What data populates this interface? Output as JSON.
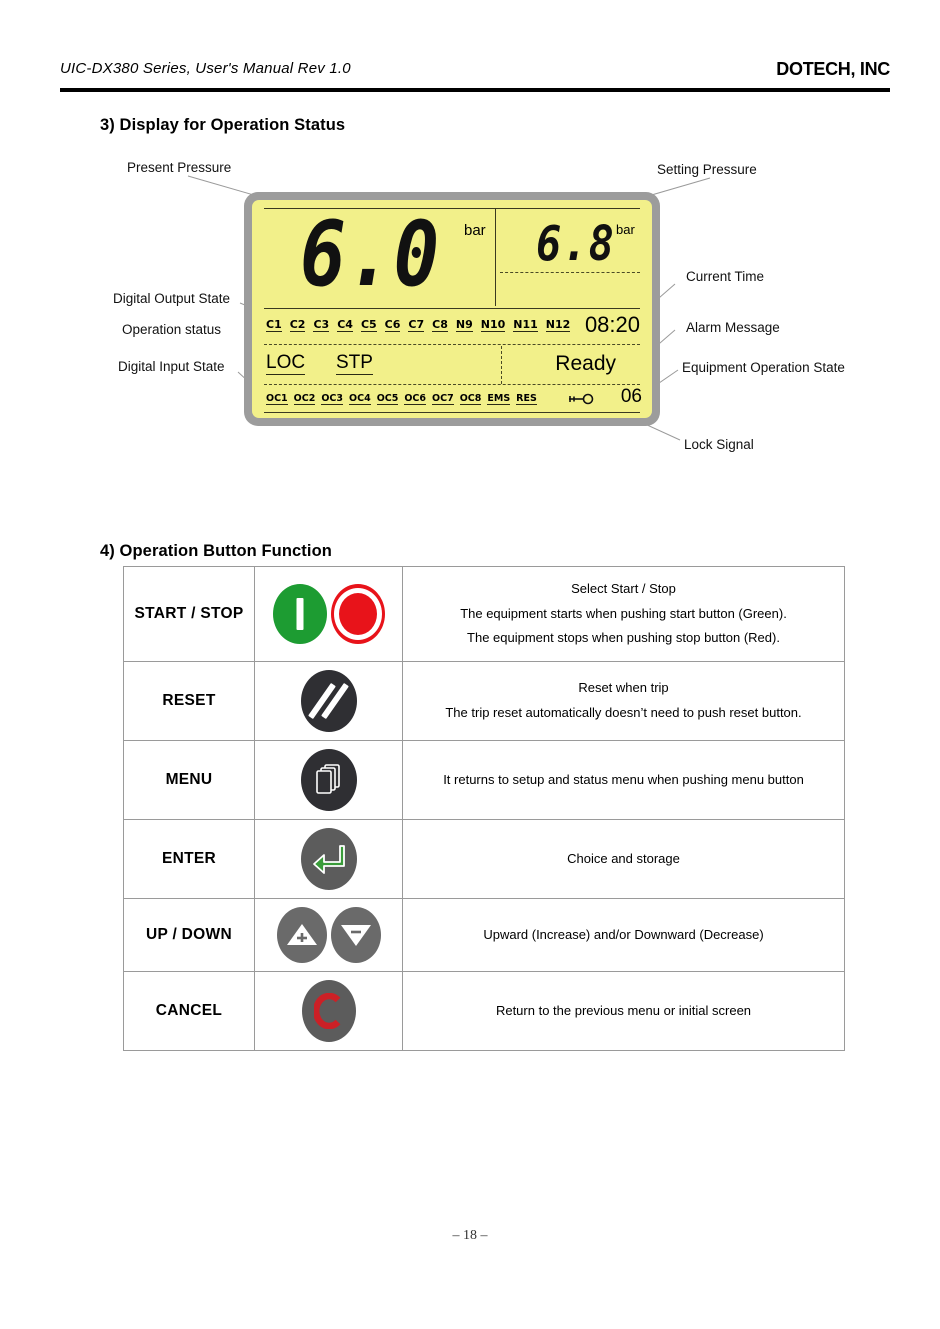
{
  "header": {
    "title": "UIC-DX380 Series, User's Manual Rev 1.0",
    "brand": "DOTECH, INC"
  },
  "sections": {
    "display_status": "3) Display for Operation Status",
    "button_function": "4) Operation Button Function"
  },
  "lcd": {
    "present_pressure_value": "6.0",
    "present_pressure_unit": "bar",
    "setting_pressure_value": "6.8",
    "setting_pressure_unit": "bar",
    "digital_output_state": [
      "C1",
      "C2",
      "C3",
      "C4",
      "C5",
      "C6",
      "C7",
      "C8",
      "N9",
      "N10",
      "N11",
      "N12"
    ],
    "digital_input_state": [
      "OC1",
      "OC2",
      "OC3",
      "OC4",
      "OC5",
      "OC6",
      "OC7",
      "OC8",
      "EMS",
      "RES"
    ],
    "current_time": "08:20",
    "operation_status_left": "LOC",
    "operation_status_right": "STP",
    "equipment_operation_state": "Ready",
    "lock_code": "06",
    "lock_icon": "key-icon",
    "screen_color": "#f2f08a",
    "bezel_color": "#9c9c9c"
  },
  "callouts": {
    "present_pressure": "Present Pressure",
    "setting_pressure": "Setting Pressure",
    "digital_output_state": "Digital Output State",
    "operation_status": "Operation status",
    "digital_input_state": "Digital Input State",
    "current_time": "Current Time",
    "alarm_message": "Alarm Message",
    "equipment_operation_state": "Equipment Operation State",
    "lock_signal": "Lock Signal"
  },
  "button_table": {
    "rows": [
      {
        "name": "START / STOP",
        "icons": [
          "start-button-icon",
          "stop-button-icon"
        ],
        "desc": [
          "Select Start / Stop",
          "The equipment starts when pushing start button (Green).",
          "The equipment stops when pushing stop button (Red)."
        ]
      },
      {
        "name": "RESET",
        "icons": [
          "reset-button-icon"
        ],
        "desc": [
          "Reset when trip",
          "The trip reset automatically doesn’t need to push reset button."
        ]
      },
      {
        "name": "MENU",
        "icons": [
          "menu-button-icon"
        ],
        "desc": [
          "It returns to setup and status menu when pushing menu button"
        ]
      },
      {
        "name": "ENTER",
        "icons": [
          "enter-button-icon"
        ],
        "desc": [
          "Choice and storage"
        ]
      },
      {
        "name": "UP / DOWN",
        "icons": [
          "up-button-icon",
          "down-button-icon"
        ],
        "desc": [
          "Upward (Increase) and/or Downward (Decrease)"
        ]
      },
      {
        "name": "CANCEL",
        "icons": [
          "cancel-button-icon"
        ],
        "desc": [
          "Return to the previous menu or initial screen"
        ]
      }
    ]
  },
  "footer": {
    "page_number": "– 18 –"
  },
  "colors": {
    "start_green": "#1d9c32",
    "stop_red": "#e8131a",
    "dark_button": "#2f2f33",
    "gray_button": "#5c5c5c",
    "enter_green": "#3a9c3a",
    "cancel_red": "#cc2026"
  }
}
